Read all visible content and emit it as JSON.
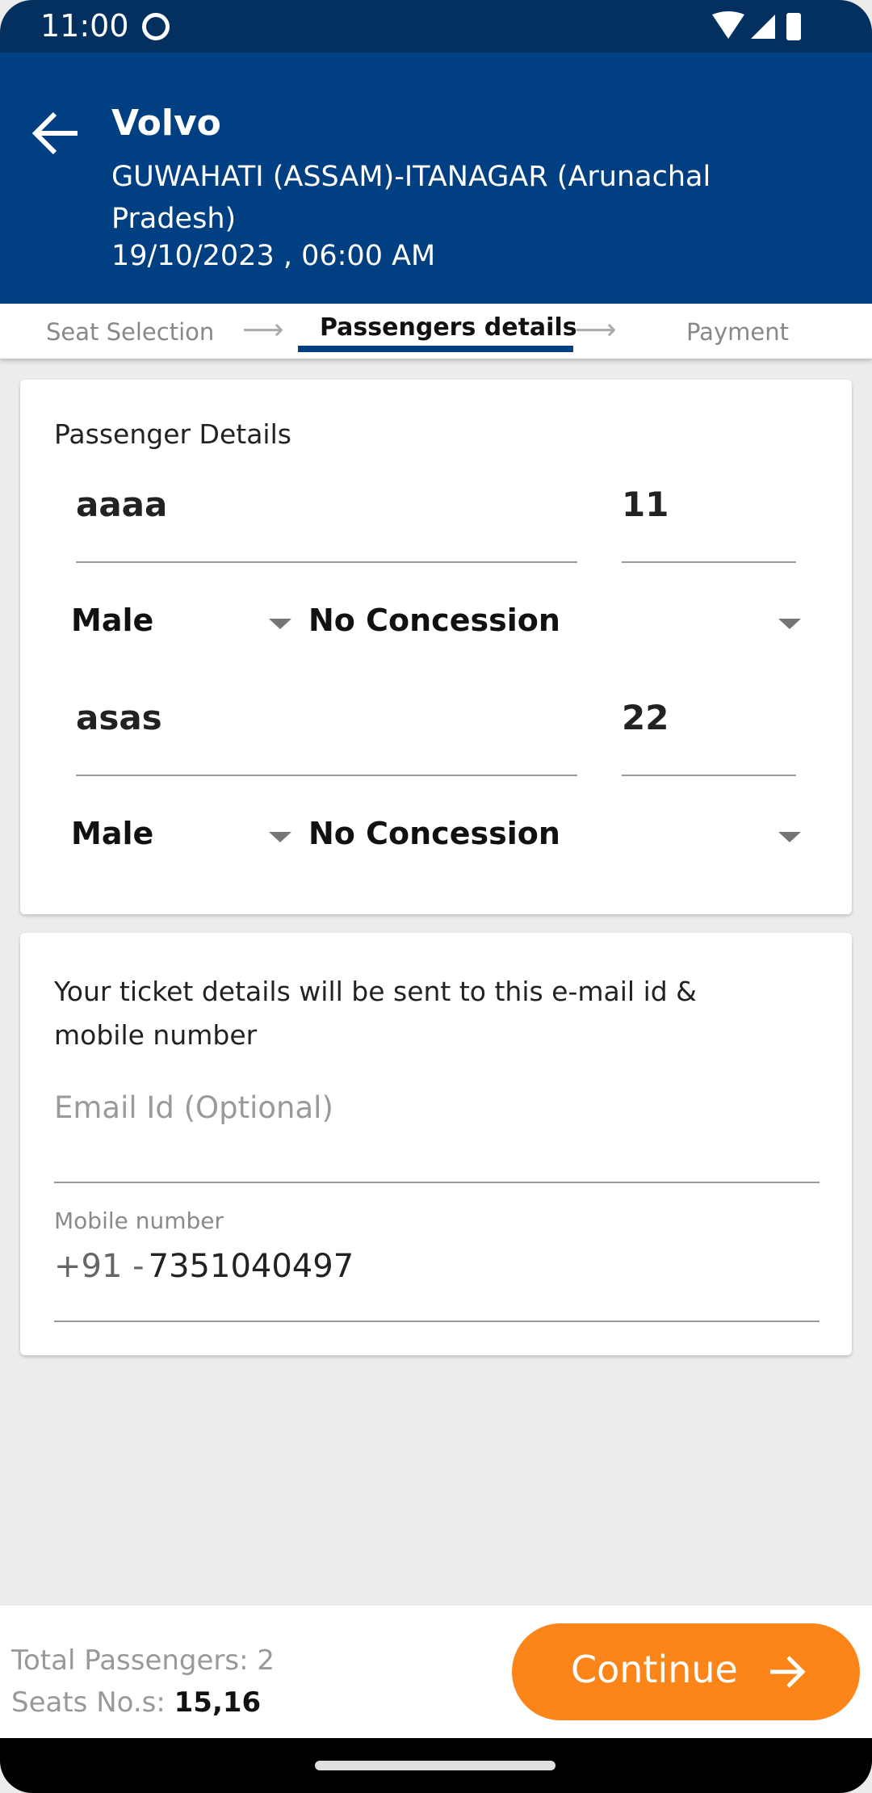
{
  "status_bar": {
    "time": "11:00",
    "icons": [
      "notification-icon",
      "wifi-icon",
      "signal-icon",
      "battery-icon"
    ]
  },
  "header": {
    "title": "Volvo",
    "route": "GUWAHATI (ASSAM)-ITANAGAR (Arunachal Pradesh)",
    "datetime": "19/10/2023 , 06:00 AM"
  },
  "stepper": {
    "steps": [
      "Seat Selection",
      "Passengers details",
      "Payment"
    ],
    "active": "Passengers details"
  },
  "passengers": {
    "title": "Passenger Details",
    "list": [
      {
        "name": "aaaa",
        "age": "11",
        "gender": "Male",
        "concession": "No Concession"
      },
      {
        "name": "asas",
        "age": "22",
        "gender": "Male",
        "concession": "No Concession"
      }
    ]
  },
  "contact": {
    "info": "Your ticket details will be sent to this e-mail id & mobile number",
    "email_placeholder": "Email Id (Optional)",
    "mobile_label": "Mobile number",
    "country_code": "+91 -",
    "mobile": "7351040497"
  },
  "footer": {
    "total_label": "Total Passengers: 2",
    "seats_label": "Seats No.s:",
    "seats": "15,16",
    "continue_label": "Continue"
  },
  "colors": {
    "header": "#003f82",
    "accent": "#fb8519"
  }
}
